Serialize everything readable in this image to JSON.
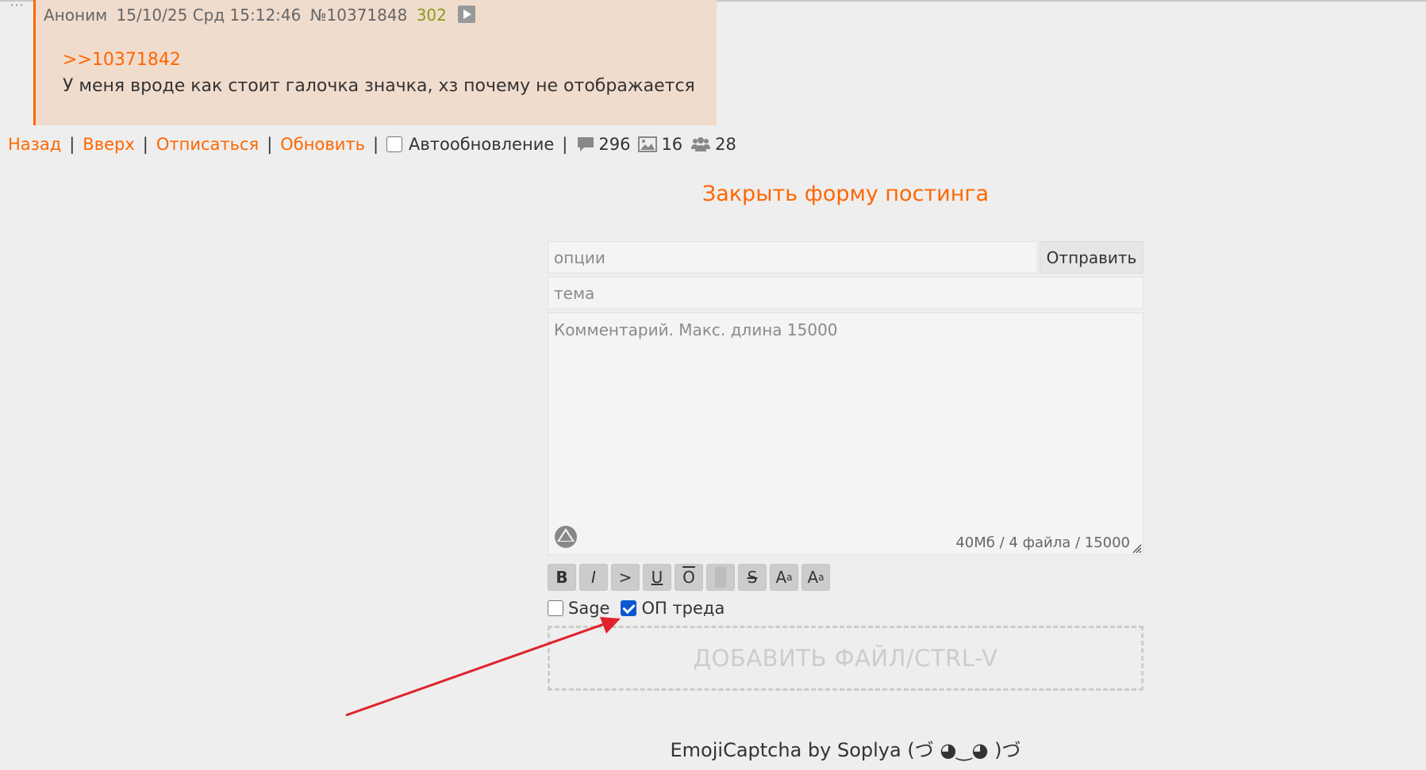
{
  "post": {
    "author": "Аноним",
    "datetime": "15/10/25 Срд 15:12:46",
    "number": "№10371848",
    "reply_count": "302",
    "reply_link": ">>10371842",
    "text": "У меня вроде как стоит галочка значка, хз почему не отображается",
    "icon": "play-icon"
  },
  "thread_nav": {
    "back": "Назад",
    "up": "Вверх",
    "unsubscribe": "Отписаться",
    "refresh": "Обновить",
    "separator": "|",
    "autorefresh_label": "Автообновление",
    "autorefresh_checked": false,
    "posts_count": "296",
    "images_count": "16",
    "posters_count": "28"
  },
  "form": {
    "close_label": "Закрыть форму постинга",
    "options_placeholder": "опции",
    "options_value": "",
    "submit_label": "Отправить",
    "subject_placeholder": "тема",
    "subject_value": "",
    "comment_placeholder": "Комментарий. Макс. длина 15000",
    "comment_value": "",
    "limits": "40Мб / 4 файла / 15000",
    "markup_buttons": {
      "bold": "B",
      "italic": "I",
      "quote": ">",
      "underline": "U",
      "overline": "O",
      "strike": "S",
      "sup_base": "A",
      "sup_mark": "a",
      "sub_base": "A",
      "sub_mark": "a"
    },
    "sage_label": "Sage",
    "sage_checked": false,
    "op_label": "ОП треда",
    "op_checked": true,
    "file_drop_label": "ДОБАВИТЬ ФАЙЛ/CTRL-V"
  },
  "captcha": {
    "title": "EmojiCaptcha by Soplya (づ ◕‿◕ )づ"
  },
  "colors": {
    "accent": "#ff6600",
    "post_bg": "#f0dccd",
    "reply_count": "#8b9c1c",
    "checkbox_checked": "#0b57d0",
    "annotation_arrow": "#e0232b"
  }
}
